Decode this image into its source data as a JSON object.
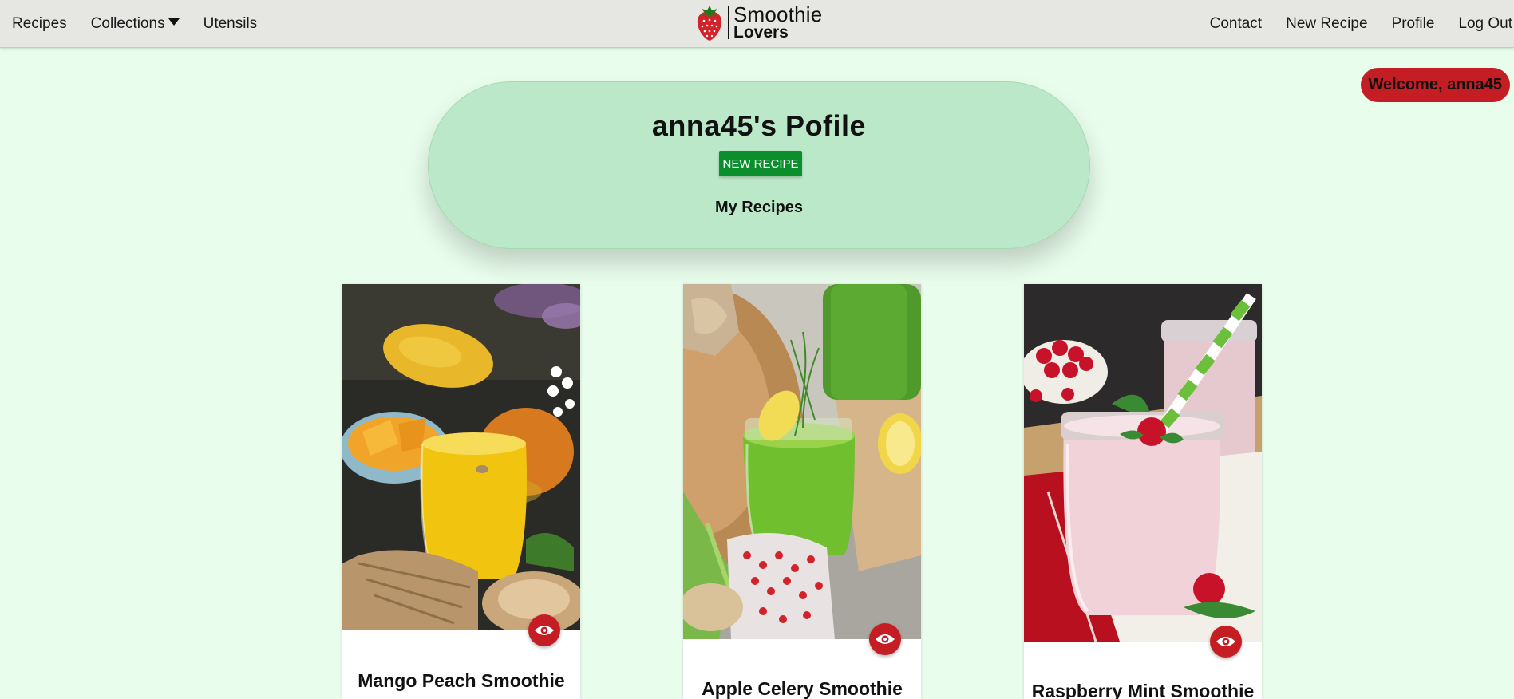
{
  "nav": {
    "left": [
      {
        "label": "Recipes"
      },
      {
        "label": "Collections"
      },
      {
        "label": "Utensils"
      }
    ],
    "right": [
      {
        "label": "Contact"
      },
      {
        "label": "New Recipe"
      },
      {
        "label": "Profile"
      },
      {
        "label": "Log Out"
      }
    ]
  },
  "logo": {
    "line1": "Smoothie",
    "line2": "Lovers"
  },
  "welcome": "Welcome, anna45",
  "profile": {
    "title": "anna45's Pofile",
    "new_recipe_button": "NEW RECIPE",
    "section_heading": "My Recipes"
  },
  "recipes": [
    {
      "title": "Mango Peach Smoothie",
      "icon": "eye-icon"
    },
    {
      "title": "Apple Celery Smoothie",
      "icon": "eye-icon"
    },
    {
      "title": "Raspberry Mint Smoothie",
      "icon": "eye-icon"
    }
  ],
  "colors": {
    "page_background": "#e9fdec",
    "navbar": "#e6e6e3",
    "accent_red": "#c41e24",
    "profile_card": "#bbe8c8",
    "button_green": "#0a8f2c"
  }
}
